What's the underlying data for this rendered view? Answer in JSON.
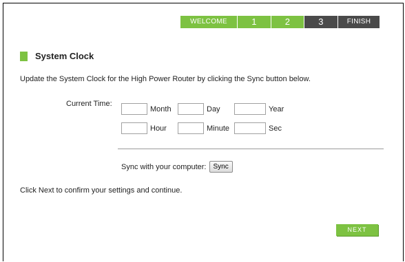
{
  "wizard": {
    "steps": [
      {
        "label": "WELCOME",
        "state": "done"
      },
      {
        "label": "1",
        "state": "done"
      },
      {
        "label": "2",
        "state": "done"
      },
      {
        "label": "3",
        "state": "current"
      },
      {
        "label": "FINISH",
        "state": "upcoming"
      }
    ]
  },
  "section": {
    "title": "System Clock",
    "description": "Update the System Clock for the High Power Router by clicking the Sync button below."
  },
  "clock": {
    "current_time_label": "Current Time:",
    "month": {
      "unit": "Month",
      "value": ""
    },
    "day": {
      "unit": "Day",
      "value": ""
    },
    "year": {
      "unit": "Year",
      "value": ""
    },
    "hour": {
      "unit": "Hour",
      "value": ""
    },
    "minute": {
      "unit": "Minute",
      "value": ""
    },
    "sec": {
      "unit": "Sec",
      "value": ""
    }
  },
  "sync": {
    "label": "Sync with your computer:",
    "button": "Sync"
  },
  "footer": {
    "confirm_text": "Click Next to confirm your settings and continue.",
    "next_button": "NEXT"
  },
  "colors": {
    "accent_green": "#7dc242",
    "step_dark": "#4a4a4a"
  }
}
